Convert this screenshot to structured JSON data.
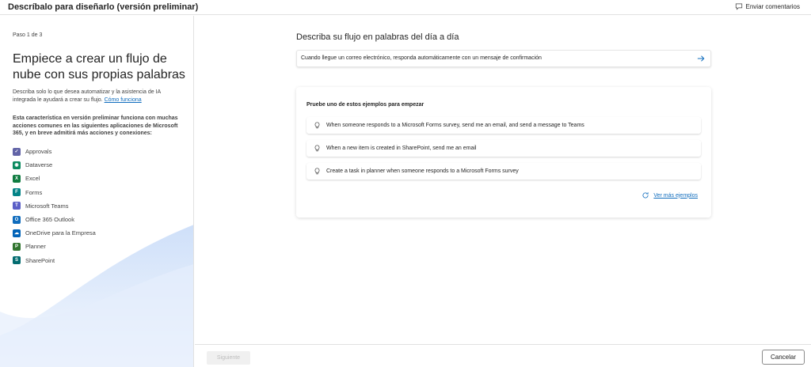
{
  "topbar": {
    "title": "Descríbalo para diseñarlo (versión preliminar)",
    "feedback_label": "Enviar comentarios"
  },
  "left": {
    "step": "Paso 1 de 3",
    "heading": "Empiece a crear un flujo de nube con sus propias palabras",
    "description": "Describa solo lo que desea automatizar y la asistencia de IA integrada le ayudará a crear su flujo.",
    "how_link": "Cómo funciona",
    "note": "Esta característica en versión preliminar funciona con muchas acciones comunes en las siguientes aplicaciones de Microsoft 365, y en breve admitirá más acciones y conexiones:",
    "apps": [
      {
        "label": "Approvals",
        "icon": "approvals-icon",
        "color": "#6264a7"
      },
      {
        "label": "Dataverse",
        "icon": "dataverse-icon",
        "color": "#0b8a5f"
      },
      {
        "label": "Excel",
        "icon": "excel-icon",
        "color": "#107c41"
      },
      {
        "label": "Forms",
        "icon": "forms-icon",
        "color": "#038387"
      },
      {
        "label": "Microsoft Teams",
        "icon": "teams-icon",
        "color": "#5b5fc7"
      },
      {
        "label": "Office 365 Outlook",
        "icon": "outlook-icon",
        "color": "#0f6cbd"
      },
      {
        "label": "OneDrive para la Empresa",
        "icon": "onedrive-icon",
        "color": "#0364b8"
      },
      {
        "label": "Planner",
        "icon": "planner-icon",
        "color": "#31752f"
      },
      {
        "label": "SharePoint",
        "icon": "sharepoint-icon",
        "color": "#036c70"
      }
    ]
  },
  "main": {
    "title": "Describa su flujo en palabras del día a día",
    "prompt_value": "Cuando llegue un correo electrónico, responda automáticamente con un mensaje de confirmación",
    "examples_title": "Pruebe uno de estos ejemplos para empezar",
    "examples": [
      "When someone responds to a Microsoft Forms survey, send me an email, and send a message to Teams",
      "When a new item is created in SharePoint, send me an email",
      "Create a task in planner when someone responds to a Microsoft Forms survey"
    ],
    "more_examples": "Ver más ejemplos"
  },
  "footer": {
    "next_label": "Siguiente",
    "cancel_label": "Cancelar"
  },
  "colors": {
    "accent": "#0f6cbd",
    "wave": "#dbe8fb"
  }
}
